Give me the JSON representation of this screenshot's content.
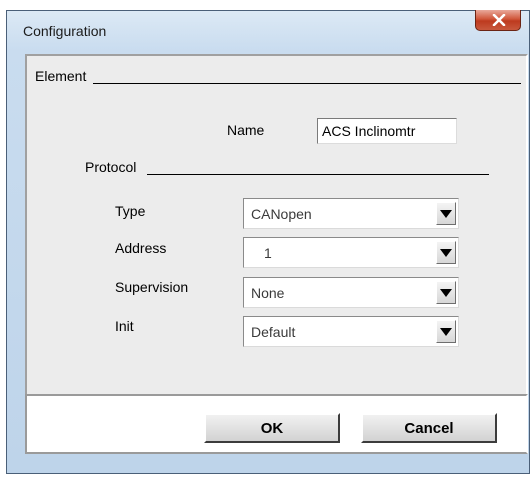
{
  "window": {
    "title": "Configuration"
  },
  "element_group": {
    "label": "Element",
    "name_label": "Name",
    "name_value": "ACS Inclinomtr"
  },
  "protocol_group": {
    "label": "Protocol",
    "fields": [
      {
        "label": "Type",
        "value": "CANopen"
      },
      {
        "label": "Address",
        "value": "1"
      },
      {
        "label": "Supervision",
        "value": "None"
      },
      {
        "label": "Init",
        "value": "Default"
      }
    ]
  },
  "buttons": {
    "ok": "OK",
    "cancel": "Cancel"
  },
  "colors": {
    "close_button": "#c8442a",
    "client_background": "#ececec",
    "frame_background": "#c9dcef"
  },
  "icons": {
    "close": "close-x-icon",
    "dropdown": "dropdown-arrow-icon"
  }
}
